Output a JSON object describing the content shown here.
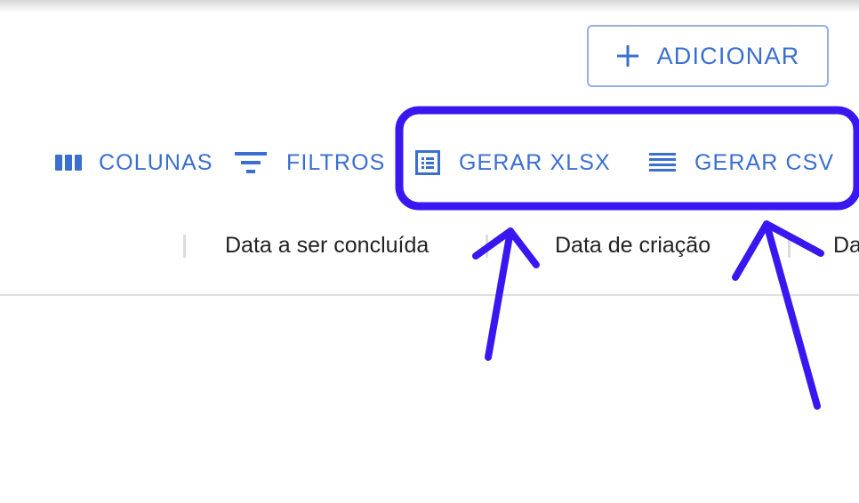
{
  "actions": {
    "add_label": "ADICIONAR",
    "add_icon": "plus-icon"
  },
  "toolbar": {
    "columns_label": "COLUNAS",
    "columns_icon": "view-column-icon",
    "filters_label": "FILTROS",
    "filters_icon": "filter-list-icon",
    "xlsx_label": "GERAR XLSX",
    "xlsx_icon": "list-alt-icon",
    "csv_label": "GERAR CSV",
    "csv_icon": "lines-icon"
  },
  "table": {
    "columns": [
      "Data a ser concluída",
      "Data de criação",
      "Da"
    ]
  },
  "colors": {
    "accent": "#3a6fd0",
    "annotation": "#3a17f0",
    "header_text": "#222222"
  }
}
